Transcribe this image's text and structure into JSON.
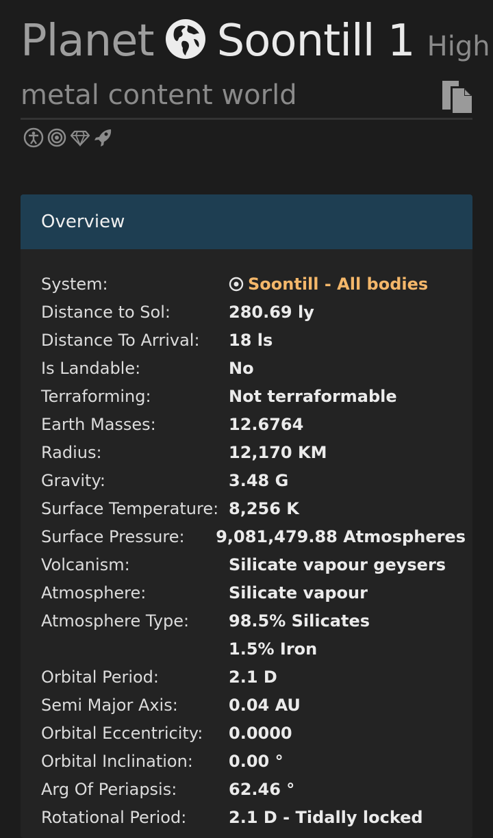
{
  "header": {
    "kind": "Planet",
    "name": "Soontill 1",
    "subtitle_part1": "High",
    "subtitle_part2": "metal content world",
    "icons": [
      "globe-icon",
      "copy-icon"
    ],
    "badges": [
      "accessibility-icon",
      "target-icon",
      "diamond-icon",
      "rocket-icon"
    ]
  },
  "overview": {
    "title": "Overview",
    "system": {
      "label": "System:",
      "name": "Soontill",
      "link": "All bodies",
      "sep": " - "
    },
    "rows": [
      {
        "label": "Distance to Sol:",
        "value": "280.69 ly"
      },
      {
        "label": "Distance To Arrival:",
        "value": "18 ls"
      },
      {
        "label": "Is Landable:",
        "value": "No"
      },
      {
        "label": "Terraforming:",
        "value": "Not terraformable"
      },
      {
        "label": "Earth Masses:",
        "value": "12.6764"
      },
      {
        "label": "Radius:",
        "value": "12,170 KM"
      },
      {
        "label": "Gravity:",
        "value": "3.48 G"
      },
      {
        "label": "Surface Temperature:",
        "value": "8,256 K"
      },
      {
        "label": "Surface Pressure:",
        "value": "9,081,479.88 Atmospheres"
      },
      {
        "label": "Volcanism:",
        "value": "Silicate vapour geysers"
      },
      {
        "label": "Atmosphere:",
        "value": "Silicate vapour"
      },
      {
        "label": "Atmosphere Type:",
        "value": "98.5% Silicates"
      },
      {
        "label": "",
        "value": "1.5% Iron"
      },
      {
        "label": "Orbital Period:",
        "value": "2.1 D"
      },
      {
        "label": "Semi Major Axis:",
        "value": "0.04 AU"
      },
      {
        "label": "Orbital Eccentricity:",
        "value": "0.0000"
      },
      {
        "label": "Orbital Inclination:",
        "value": "0.00 °"
      },
      {
        "label": "Arg Of Periapsis:",
        "value": "62.46 °"
      },
      {
        "label": "Rotational Period:",
        "value": "2.1 D - Tidally locked"
      }
    ]
  },
  "colors": {
    "background": "#1c1c1c",
    "panel": "#232323",
    "header": "#1e3e52",
    "link": "#f4b76a"
  }
}
